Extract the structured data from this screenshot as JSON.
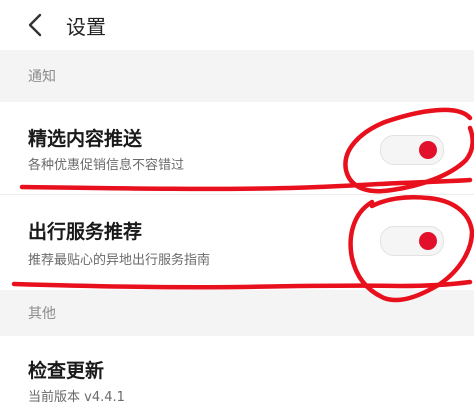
{
  "header": {
    "title": "设置",
    "back_icon": "chevron-left-icon"
  },
  "sections": {
    "notify": "通知",
    "other": "其他"
  },
  "settings": {
    "featured_push": {
      "title": "精选内容推送",
      "subtitle": "各种优惠促销信息不容错过",
      "enabled": true
    },
    "travel_service": {
      "title": "出行服务推荐",
      "subtitle": "推荐最贴心的异地出行服务指南",
      "enabled": true
    },
    "check_update": {
      "title": "检查更新",
      "subtitle": "当前版本 v4.4.1"
    }
  },
  "colors": {
    "accent": "#e2102a",
    "annotation": "#e8101c",
    "section_bg": "#f4f4f4"
  }
}
